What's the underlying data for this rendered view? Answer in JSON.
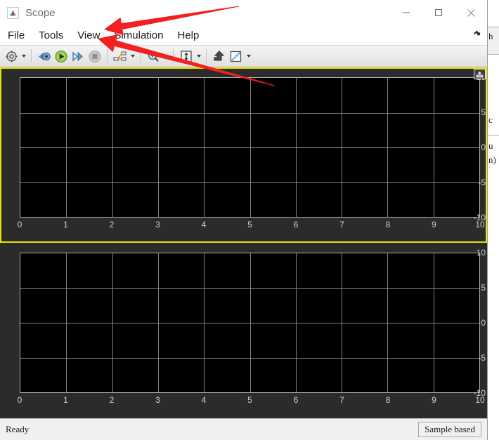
{
  "window": {
    "title": "Scope",
    "app_icon": "simulink-scope-icon",
    "controls": [
      {
        "name": "minimize-button",
        "glyph": "minimize-icon"
      },
      {
        "name": "maximize-button",
        "glyph": "maximize-icon"
      },
      {
        "name": "close-button",
        "glyph": "close-icon"
      }
    ]
  },
  "menubar": {
    "items": [
      {
        "label": "File",
        "name": "menu-file"
      },
      {
        "label": "Tools",
        "name": "menu-tools"
      },
      {
        "label": "View",
        "name": "menu-view"
      },
      {
        "label": "Simulation",
        "name": "menu-simulation"
      },
      {
        "label": "Help",
        "name": "menu-help"
      }
    ],
    "expand_icon": "expand-arrow-icon"
  },
  "toolbar": {
    "buttons": [
      {
        "name": "configuration-properties-button",
        "icon": "gear-icon",
        "has_dropdown": true
      },
      {
        "name": "simulation-rewind-button",
        "icon": "rewind-to-start-icon",
        "has_dropdown": false
      },
      {
        "name": "run-button",
        "icon": "play-icon",
        "has_dropdown": false
      },
      {
        "name": "step-forward-button",
        "icon": "step-forward-icon",
        "has_dropdown": false
      },
      {
        "name": "stop-button",
        "icon": "stop-icon",
        "has_dropdown": false
      },
      {
        "name": "signal-selector-button",
        "icon": "signal-selection-icon",
        "has_dropdown": true
      },
      {
        "name": "zoom-in-button",
        "icon": "zoom-in-icon",
        "has_dropdown": true
      },
      {
        "name": "autoscale-button",
        "icon": "autoscale-icon",
        "has_dropdown": true
      },
      {
        "name": "style-button",
        "icon": "style-arrow-icon",
        "has_dropdown": false
      },
      {
        "name": "measurements-button",
        "icon": "ruler-icon",
        "has_dropdown": true
      }
    ]
  },
  "scope": {
    "float_button": "float-undock-icon",
    "background_color": "#000000",
    "grid_color": "#808080",
    "selected_border_color": "#e6e600",
    "selected_pane_index": 0
  },
  "chart_data": [
    {
      "type": "line",
      "title": "",
      "xlabel": "",
      "ylabel": "",
      "series": [],
      "x_ticks": [
        "0",
        "1",
        "2",
        "3",
        "4",
        "5",
        "6",
        "7",
        "8",
        "9",
        "10"
      ],
      "y_ticks": [
        "10",
        "5",
        "0",
        "-5",
        "-10"
      ],
      "xlim": [
        0,
        10
      ],
      "ylim": [
        -10,
        10
      ],
      "grid": true,
      "legend": "none",
      "background": "#000000",
      "selected": true
    },
    {
      "type": "line",
      "title": "",
      "xlabel": "",
      "ylabel": "",
      "series": [],
      "x_ticks": [
        "0",
        "1",
        "2",
        "3",
        "4",
        "5",
        "6",
        "7",
        "8",
        "9",
        "10"
      ],
      "y_ticks": [
        "10",
        "5",
        "0",
        "-5",
        "-10"
      ],
      "xlim": [
        0,
        10
      ],
      "ylim": [
        -10,
        10
      ],
      "grid": true,
      "legend": "none",
      "background": "#000000",
      "selected": false
    }
  ],
  "statusbar": {
    "status": "Ready",
    "mode": "Sample based"
  },
  "background_window": {
    "fragments": [
      "h",
      "c",
      "u",
      "n)"
    ]
  },
  "annotations": {
    "arrow_color": "#f22020",
    "arrows": [
      {
        "name": "annotation-arrow-upper",
        "from": [
          340,
          9
        ],
        "to": [
          148,
          42
        ],
        "target": "menu-view"
      },
      {
        "name": "annotation-arrow-lower",
        "from": [
          391,
          122
        ],
        "to": [
          139,
          55
        ],
        "target": "menu-view"
      }
    ]
  }
}
